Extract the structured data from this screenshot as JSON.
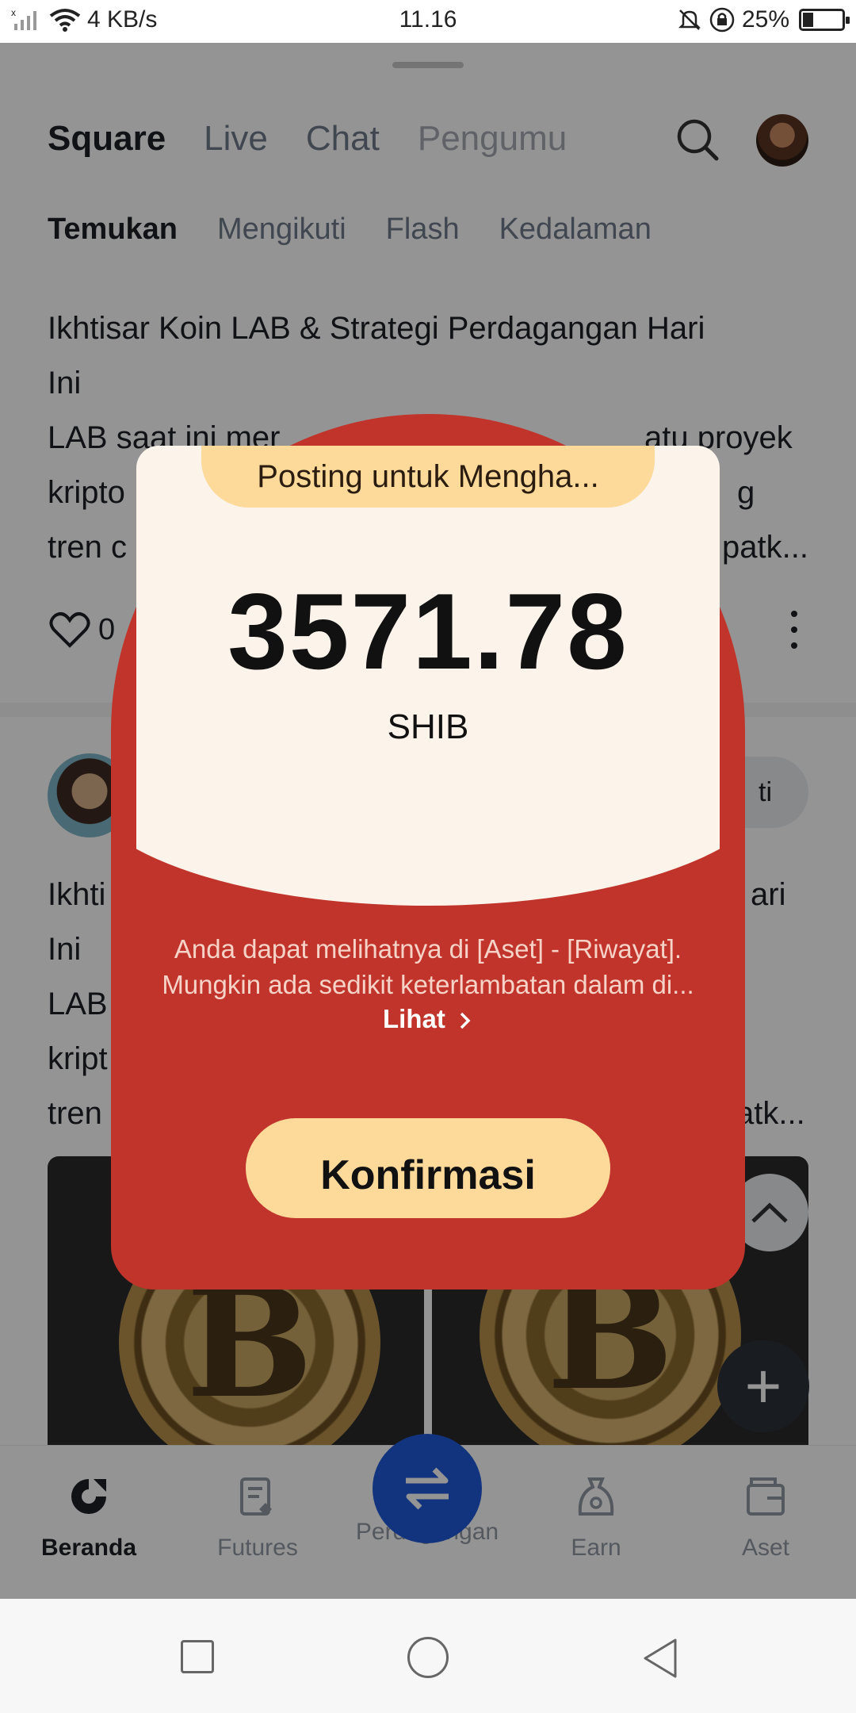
{
  "status_bar": {
    "network_speed": "4 KB/s",
    "time": "11.16",
    "battery": "25%",
    "battery_level": 0.25
  },
  "top_nav": {
    "tabs": [
      "Square",
      "Live",
      "Chat",
      "Pengumu"
    ],
    "active": "Square"
  },
  "sub_nav": {
    "tabs": [
      "Temukan",
      "Mengikuti",
      "Flash",
      "Kedalaman"
    ],
    "active": "Temukan"
  },
  "feed": {
    "post1": {
      "lines": [
        "Ikhtisar Koin LAB & Strategi Perdagangan Hari",
        "Ini",
        "LAB saat ini mer",
        "kripto",
        "tren c"
      ],
      "line3_tail": "atu proyek",
      "line4_tail": "g",
      "line5_tail": "patk...",
      "likes": "0"
    },
    "post2": {
      "lines": [
        "Ikhti",
        "Ini",
        "LAB",
        "kript",
        "tren"
      ],
      "line1_tail": "ari",
      "line5_tail": "atk...",
      "follow_partial": "ti"
    }
  },
  "bottom_tabs": [
    {
      "label": "Beranda",
      "icon": "home-icon",
      "active": true
    },
    {
      "label": "Futures",
      "icon": "futures-icon",
      "active": false
    },
    {
      "label": "Perdagangan",
      "icon": "trade-swap-icon",
      "active": false
    },
    {
      "label": "Earn",
      "icon": "earn-icon",
      "active": false
    },
    {
      "label": "Aset",
      "icon": "wallet-icon",
      "active": false
    }
  ],
  "modal": {
    "banner": "Posting untuk Mengha...",
    "amount": "3571.78",
    "currency": "SHIB",
    "info_line1": "Anda dapat melihatnya di [Aset] - [Riwayat].",
    "info_line2": "Mungkin ada sedikit keterlambatan dalam di...",
    "view_link": "Lihat",
    "confirm_label": "Konfirmasi"
  },
  "colors": {
    "modal_red": "#c0342b",
    "cream": "#fcf3ea",
    "accent_yellow": "#fdd99a",
    "trade_blue": "#1f5bd9"
  }
}
